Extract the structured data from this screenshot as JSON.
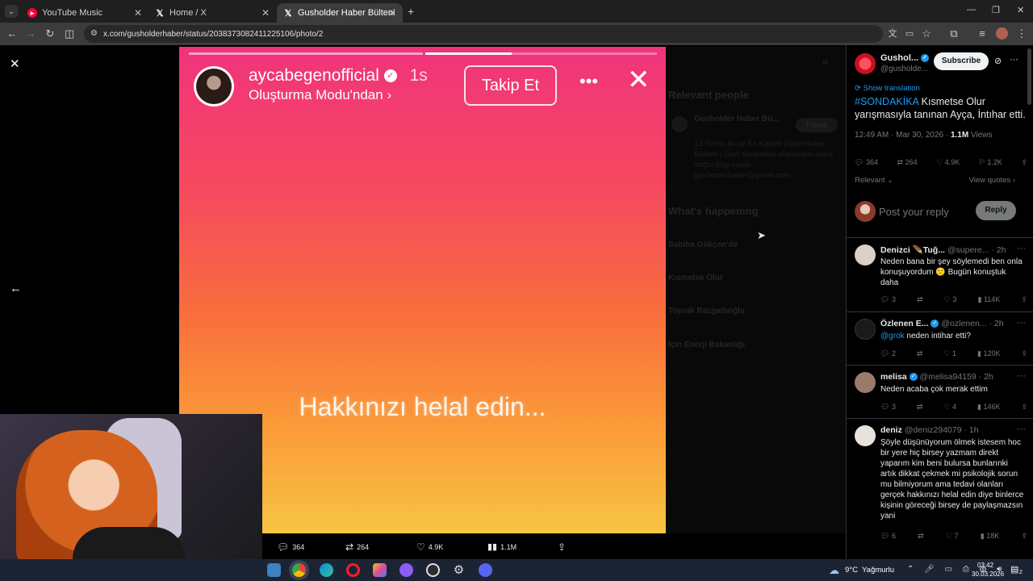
{
  "tabs": [
    {
      "title": "YouTube Music",
      "active": false
    },
    {
      "title": "Home / X",
      "active": false
    },
    {
      "title": "Gusholder Haber Bülteni on X:",
      "active": true
    }
  ],
  "address": {
    "url": "x.com/gusholderhaber/status/2038373082411225106/photo/2"
  },
  "story": {
    "username": "aycabegenofficial",
    "time": "1s",
    "mode": "Oluşturma Modu'ndan ›",
    "follow_label": "Takip Et",
    "caption": "Hakkınızı helal edin..."
  },
  "dim_panel": {
    "relevant_title": "Relevant people",
    "account_name": "Gusholder Haber Bü...",
    "follow": "Follow",
    "bio": "13 Yıl'hin İlk ve En Kaliteli Dijital Haber Bülteni | Özel sözlerdeki olaylardan daha doğru bilgi sunar. gusholderhaber@gmail.com",
    "happening_title": "What's happening",
    "trends": [
      "Sabiha Gökçen'de",
      "Kısmetse Olur",
      "Toprak Razgatlıoğlu",
      "İçin Enerji Bakanlığı"
    ]
  },
  "tweet": {
    "author": "Gushol...",
    "handle": "@gusholde...",
    "subscribe": "Subscribe",
    "translate": "Show translation",
    "hashtag": "#SONDAKİKA",
    "text": " Kısmetse Olur yarışmasıyla tanınan Ayça, İntıhar etti.",
    "time": "12:49 AM · Mar 30, 2026 ·",
    "views_count": "1.1M",
    "views_label": "Views",
    "replies": "364",
    "retweets": "264",
    "likes": "4.9K",
    "bookmarks": "1.2K",
    "sort": "Relevant",
    "view_quotes": "View quotes",
    "reply_placeholder": "Post your reply",
    "reply_button": "Reply"
  },
  "replies": [
    {
      "name": "Denizci 🪶Tuğ...",
      "handle": "@supere...",
      "age": "· 2h",
      "text": "Neden bana bir şey söylemedi ben onla konuşuyordum 🙁 Bugün konuştuk daha",
      "mention": "",
      "replies": "3",
      "retweets": "",
      "likes": "3",
      "views": "114K",
      "avatar": "#d9d0c8"
    },
    {
      "name": "Özlenen E...",
      "handle": "@ozlenen...",
      "age": "· 2h",
      "text": " neden intihar etti?",
      "mention": "@grok",
      "replies": "2",
      "retweets": "",
      "likes": "1",
      "views": "120K",
      "avatar": "#2a2a2a"
    },
    {
      "name": "melisa",
      "handle": "@melisa94159",
      "age": "· 2h",
      "text": "Neden acaba çok merak ettim",
      "mention": "",
      "replies": "3",
      "retweets": "",
      "likes": "4",
      "views": "146K",
      "avatar": "#9a7a6a"
    },
    {
      "name": "deniz",
      "handle": "@deniz294079",
      "age": "· 1h",
      "text": "Şöyle düşünüyorum ölmek istesem hoc bir yere hiç birsey yazmam direkt yaparım kim beni bulursa bunlarınki artık dikkat çekmek mi psikolojik sorun mu bilmiyorum ama tedavi olanları gerçek hakkınızı helal edin diye binlerce kişinin göreceği birsey de paylaşmazsın yani",
      "mention": "",
      "replies": "6",
      "retweets": "",
      "likes": "7",
      "views": "18K",
      "avatar": "#e8e2dc"
    }
  ],
  "actionbar": {
    "replies": "364",
    "retweets": "264",
    "likes": "4.9K",
    "views": "1.1M"
  },
  "taskbar": {
    "weather": "9°C  Yağmurlu",
    "time": "03:42",
    "date": "30.03.2026",
    "notifications": "2"
  },
  "colors": {
    "x_blue": "#1d9bf0",
    "story_top": "#f0337d",
    "story_bottom": "#f7c443"
  }
}
